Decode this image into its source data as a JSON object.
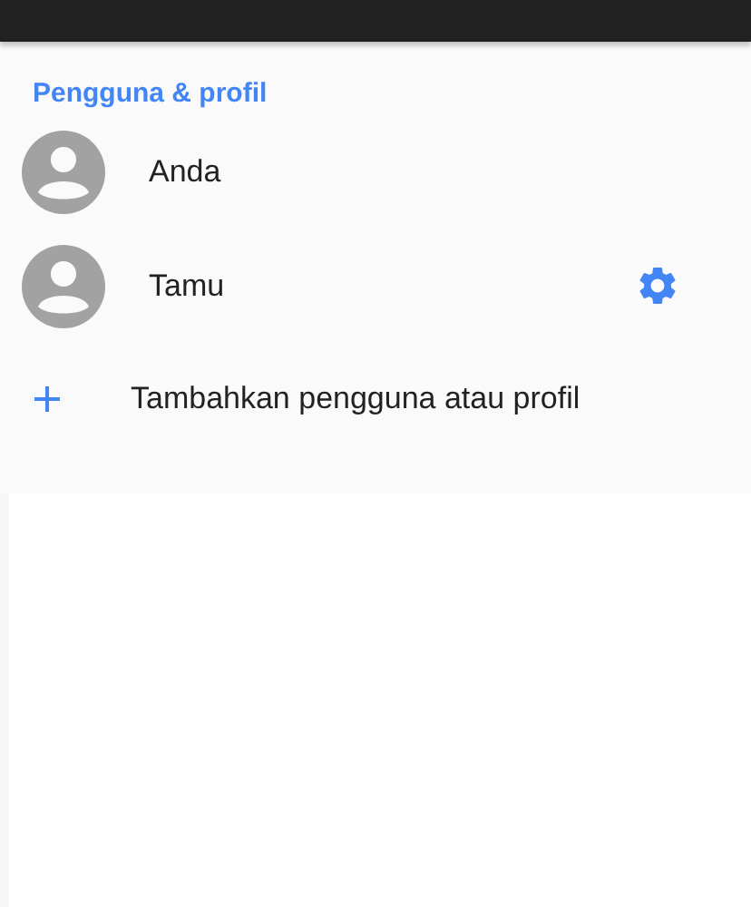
{
  "section": {
    "title": "Pengguna & profil"
  },
  "users": [
    {
      "name": "Anda",
      "kind": "user"
    },
    {
      "name": "Tamu",
      "kind": "guest"
    }
  ],
  "add_action": {
    "label": "Tambahkan pengguna atau profil"
  }
}
